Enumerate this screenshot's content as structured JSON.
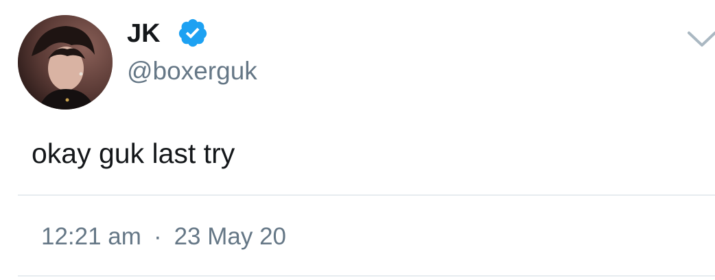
{
  "tweet": {
    "author": {
      "name": "JK",
      "handle": "@boxerguk",
      "verified": true
    },
    "text": "okay guk last try",
    "time": "12:21 am",
    "separator": "·",
    "date": "23 May 20"
  },
  "icons": {
    "verified": "verified-badge-icon",
    "menu": "chevron-down-icon"
  },
  "colors": {
    "primary_text": "#14171a",
    "secondary_text": "#657786",
    "verified_blue": "#1da1f2",
    "divider": "#e6ecf0"
  }
}
